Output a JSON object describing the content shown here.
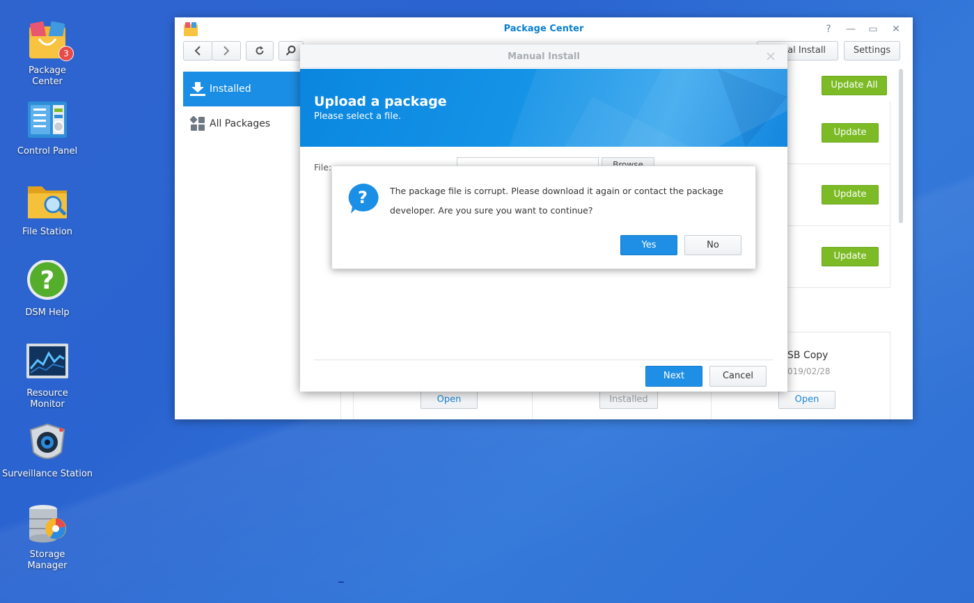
{
  "desktop": {
    "icons": [
      {
        "label": "Package\nCenter",
        "badge": "3",
        "icon": "package-center-icon"
      },
      {
        "label": "Control Panel",
        "icon": "control-panel-icon"
      },
      {
        "label": "File Station",
        "icon": "file-station-icon"
      },
      {
        "label": "DSM Help",
        "icon": "dsm-help-icon"
      },
      {
        "label": "Resource\nMonitor",
        "icon": "resource-monitor-icon"
      },
      {
        "label": "Surveillance Station",
        "icon": "surveillance-station-icon"
      },
      {
        "label": "Storage\nManager",
        "icon": "storage-manager-icon"
      }
    ]
  },
  "window": {
    "title": "Package Center",
    "controls": {
      "help": "?",
      "minimize": "—",
      "maximize": "▭",
      "close": "✕"
    },
    "toolbar": {
      "manual_install": "ual Install",
      "settings": "Settings"
    },
    "sidebar": {
      "installed": "Installed",
      "all_packages": "All Packages"
    },
    "main": {
      "update_all": "Update All",
      "update": "Update",
      "card_title": "SB Copy",
      "card_date": "019/02/28",
      "open": "Open",
      "installed": "Installed"
    }
  },
  "manual_install": {
    "title": "Manual Install",
    "banner_title": "Upload a package",
    "banner_subtitle": "Please select a file.",
    "file_label": "File:",
    "browse": "Browse",
    "next": "Next",
    "cancel": "Cancel"
  },
  "confirm": {
    "message": "The package file is corrupt. Please download it again or contact the package developer. Are you sure you want to continue?",
    "yes": "Yes",
    "no": "No"
  },
  "colors": {
    "desktop": "#2f64cf",
    "accent": "#1f8fe5",
    "title_blue": "#0a7fd0",
    "green": "#7cbb26"
  }
}
